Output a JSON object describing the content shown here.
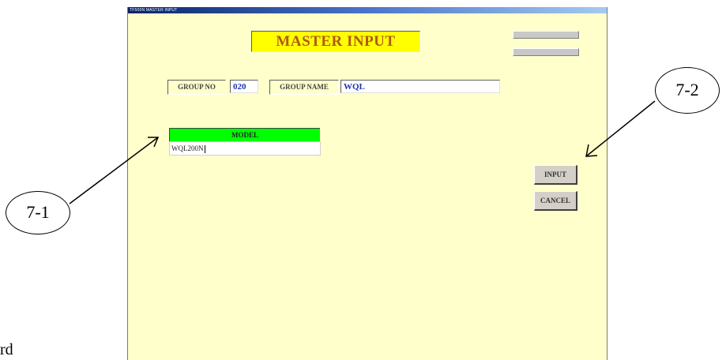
{
  "window": {
    "title": "TF500N MASTER INPUT"
  },
  "screen_title": "MASTER INPUT",
  "group": {
    "no_label": "GROUP NO",
    "no_value": "020",
    "name_label": "GROUP NAME",
    "name_value": "WQL"
  },
  "model": {
    "header": "MODEL",
    "value": "WQL200N"
  },
  "buttons": {
    "input": "INPUT",
    "cancel": "CANCEL"
  },
  "callouts": {
    "left": "7-1",
    "right": "7-2"
  },
  "page_text_fragment": "rd",
  "colors": {
    "window_bg": "#ffffcc",
    "title_bg": "#ffff00",
    "title_text": "#b05a10",
    "model_header_bg": "#00ff00",
    "field_value_text": "#2233aa"
  }
}
